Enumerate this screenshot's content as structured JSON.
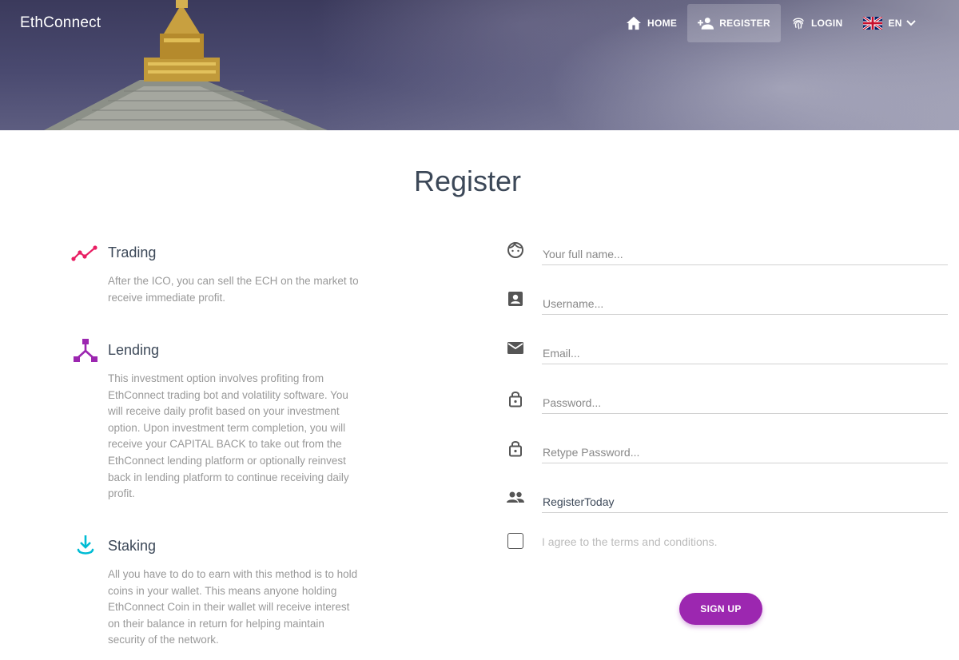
{
  "header": {
    "brand": "EthConnect",
    "nav": {
      "home": "HOME",
      "register": "REGISTER",
      "login": "LOGIN",
      "language": "EN"
    }
  },
  "page": {
    "title": "Register"
  },
  "features": [
    {
      "icon": "trending-up-icon",
      "title": "Trading",
      "text": "After the ICO, you can sell the ECH on the market to receive immediate profit.",
      "color": "#e91e63"
    },
    {
      "icon": "call-split-icon",
      "title": "Lending",
      "text": "This investment option involves profiting from EthConnect trading bot and volatility software. You will receive daily profit based on your investment option. Upon investment term completion, you will receive your CAPITAL BACK to take out from the EthConnect lending platform or optionally reinvest back in lending platform to continue receiving daily profit.",
      "color": "#9c27b0"
    },
    {
      "icon": "download-icon",
      "title": "Staking",
      "text": "All you have to do to earn with this method is to hold coins in your wallet. This means anyone holding EthConnect Coin in their wallet will receive interest on their balance in return for helping maintain security of the network.",
      "color": "#00bcd4"
    }
  ],
  "form": {
    "fullname_placeholder": "Your full name...",
    "username_placeholder": "Username...",
    "email_placeholder": "Email...",
    "password_placeholder": "Password...",
    "retype_placeholder": "Retype Password...",
    "referral_value": "RegisterToday",
    "terms_label": "I agree to the terms and conditions.",
    "signup_label": "SIGN UP"
  },
  "colors": {
    "accent": "#9c27b0",
    "trading": "#e91e63",
    "staking": "#00bcd4"
  }
}
